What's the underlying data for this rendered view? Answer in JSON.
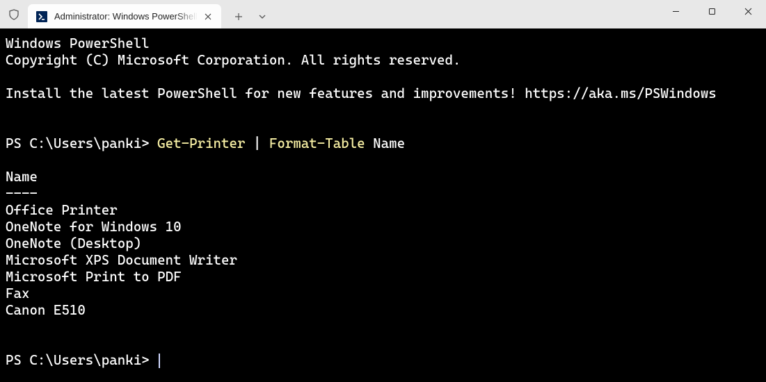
{
  "titlebar": {
    "tab_title": "Administrator: Windows PowerShell",
    "tab_icon_label": ">_"
  },
  "terminal": {
    "banner_line1": "Windows PowerShell",
    "banner_line2": "Copyright (C) Microsoft Corporation. All rights reserved.",
    "banner_line3": "Install the latest PowerShell for new features and improvements! https://aka.ms/PSWindows",
    "prompt1_prefix": "PS C:\\Users\\panki> ",
    "prompt1_cmd1": "Get-Printer",
    "prompt1_mid": " | ",
    "prompt1_cmd2": "Format-Table",
    "prompt1_suffix": " Name",
    "column_header": "Name",
    "column_underline": "----",
    "printers": [
      "Office Printer",
      "OneNote for Windows 10",
      "OneNote (Desktop)",
      "Microsoft XPS Document Writer",
      "Microsoft Print to PDF",
      "Fax",
      "Canon E510"
    ],
    "prompt2_prefix": "PS C:\\Users\\panki> "
  }
}
